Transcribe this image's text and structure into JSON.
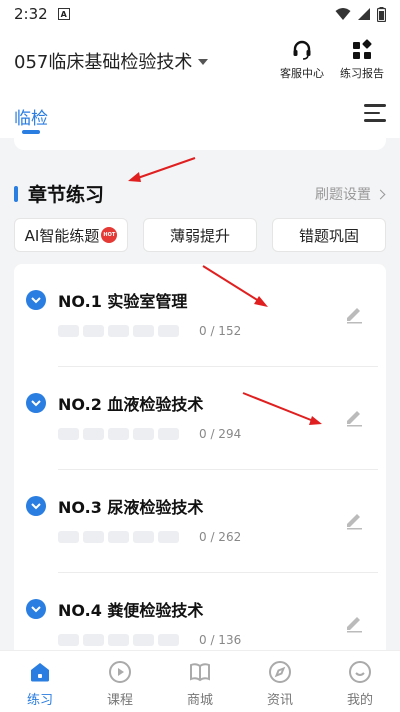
{
  "status_bar": {
    "time": "2:32",
    "notification_glyph": "A"
  },
  "header": {
    "course_title": "057临床基础检验技术",
    "service_label": "客服中心",
    "report_label": "练习报告"
  },
  "tabs": {
    "active_tab": "临检"
  },
  "section": {
    "title": "章节练习",
    "settings_label": "刷题设置"
  },
  "quick_actions": [
    {
      "label": "AI智能练题",
      "badge": "HOT"
    },
    {
      "label": "薄弱提升"
    },
    {
      "label": "错题巩固"
    }
  ],
  "chapters": [
    {
      "title": "NO.1 实验室管理",
      "progress": "0 / 152"
    },
    {
      "title": "NO.2 血液检验技术",
      "progress": "0 / 294"
    },
    {
      "title": "NO.3 尿液检验技术",
      "progress": "0 / 262"
    },
    {
      "title": "NO.4 粪便检验技术",
      "progress": "0 / 136"
    }
  ],
  "bottom_nav": [
    {
      "label": "练习",
      "icon": "home-icon",
      "active": true
    },
    {
      "label": "课程",
      "icon": "play-icon"
    },
    {
      "label": "商城",
      "icon": "book-icon"
    },
    {
      "label": "资讯",
      "icon": "compass-icon"
    },
    {
      "label": "我的",
      "icon": "smile-icon"
    }
  ],
  "colors": {
    "accent": "#2a7de1",
    "annotation_arrow": "#e02020",
    "hot_badge": "#e53935"
  }
}
